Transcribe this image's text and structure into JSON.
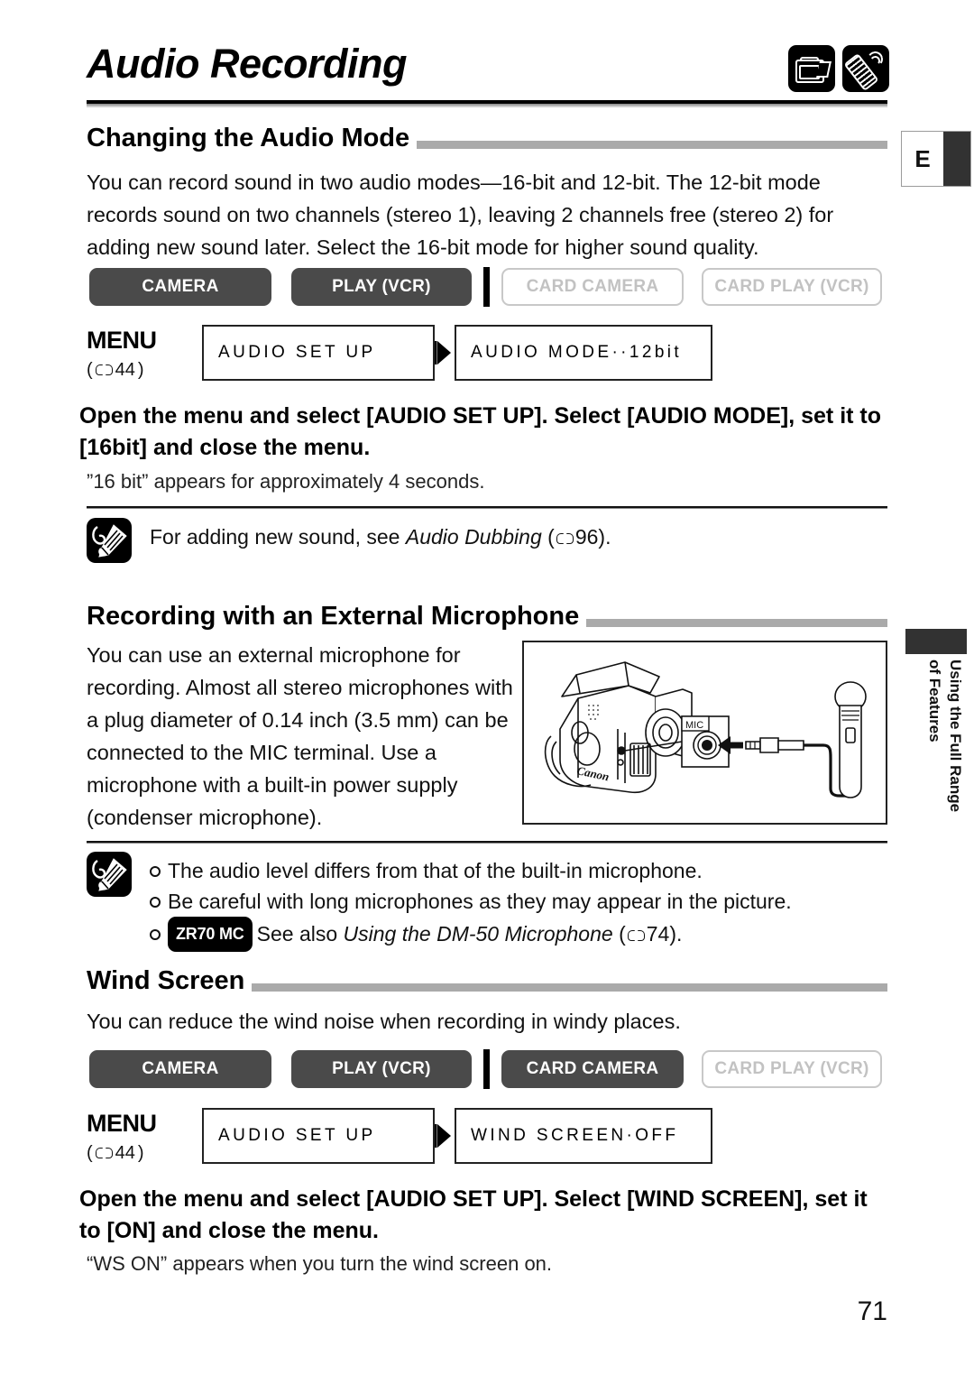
{
  "header": {
    "title": "Audio Recording",
    "icons": [
      "camcorder-icon",
      "remote-control-icon"
    ],
    "lang_tab": "E"
  },
  "side_tab": {
    "line1": "Using the Full Range",
    "line2": "of Features"
  },
  "sections": [
    {
      "heading": "Changing the Audio Mode",
      "body": "You can record sound in two audio modes—16-bit and 12-bit. The 12-bit mode records sound on two channels (stereo 1), leaving 2 channels free (stereo 2) for adding new sound later. Select the 16-bit mode for higher sound quality.",
      "modes": [
        {
          "label": "CAMERA",
          "active": true
        },
        {
          "label": "PLAY (VCR)",
          "active": true
        },
        {
          "label": "CARD CAMERA",
          "active": false
        },
        {
          "label": "CARD PLAY (VCR)",
          "active": false
        }
      ],
      "menu": {
        "label": "MENU",
        "page_ref": "44",
        "box1": "AUDIO SET UP",
        "box2": "AUDIO MODE··12bit"
      },
      "instruction": "Open the menu and select [AUDIO SET UP]. Select [AUDIO MODE], set it to [16bit] and close the menu.",
      "sub_note": "”16 bit” appears for approximately 4 seconds."
    },
    {
      "heading": "Recording with an External Microphone",
      "body": "You can use an external microphone for recording. Almost all stereo microphones with a plug diameter of 0.14 inch (3.5 mm) can be connected to the MIC terminal. Use a microphone with a built-in power supply (condenser microphone).",
      "figure": {
        "terminal_label": "MIC",
        "brand_label": "Canon"
      }
    },
    {
      "heading": "Wind Screen",
      "body": "You can reduce the wind noise when recording in windy places.",
      "modes": [
        {
          "label": "CAMERA",
          "active": true
        },
        {
          "label": "PLAY (VCR)",
          "active": true
        },
        {
          "label": "CARD CAMERA",
          "active": true
        },
        {
          "label": "CARD PLAY (VCR)",
          "active": false
        }
      ],
      "menu": {
        "label": "MENU",
        "page_ref": "44",
        "box1": "AUDIO SET UP",
        "box2": "WIND SCREEN·OFF"
      },
      "instruction": "Open the menu and select [AUDIO SET UP]. Select [WIND SCREEN], set it to [ON] and close the menu.",
      "sub_note": "“WS ON” appears when you turn the wind screen on."
    }
  ],
  "notes": {
    "audio_dubbing": {
      "before": "For adding new sound, see ",
      "italic": "Audio Dubbing",
      "paren_open": "(",
      "page_ref": "96",
      "paren_close": ").",
      "icon": "pencil-note-icon"
    },
    "mic_notes": {
      "icon": "pencil-note-icon",
      "line1": "The audio level differs from that of the built-in microphone.",
      "line2": "Be careful with long microphones as they may appear in the picture.",
      "line3_badge": "ZR70 MC",
      "line3_before": "See also ",
      "line3_italic": "Using the DM-50 Microphone",
      "line3_paren_open": "(",
      "line3_page_ref": "74",
      "line3_paren_close": ")."
    }
  },
  "page_number": "71"
}
